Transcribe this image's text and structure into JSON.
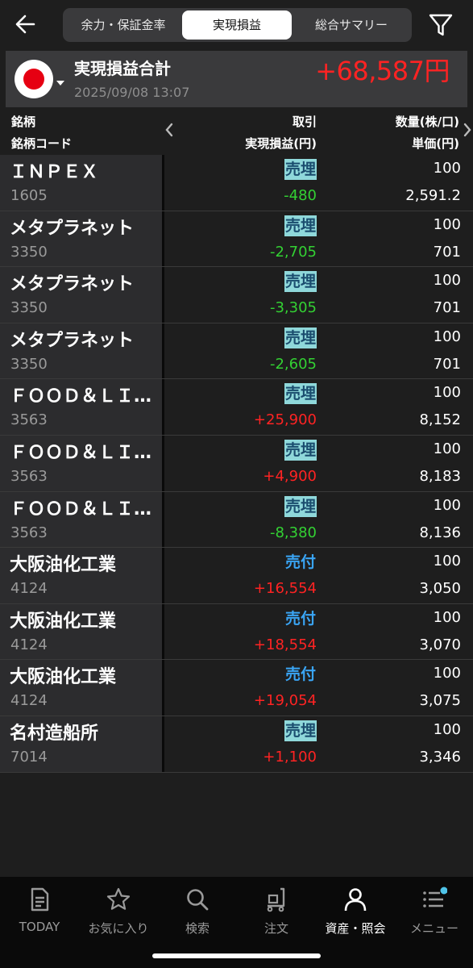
{
  "tabs": [
    {
      "label": "余力・保証金率"
    },
    {
      "label": "実現損益"
    },
    {
      "label": "総合サマリー"
    }
  ],
  "summary": {
    "title": "実現損益合計",
    "datetime": "2025/09/08 13:07",
    "total": "+68,587円",
    "market_flag": "japan-flag-icon"
  },
  "columns": {
    "name": "銘柄",
    "code": "銘柄コード",
    "trade": "取引",
    "pl": "実現損益(円)",
    "qty": "数量(株/口)",
    "price": "単価(円)"
  },
  "rows": [
    {
      "name": "ＩＮＰＥＸ",
      "code": "1605",
      "trade": "売埋",
      "trade_type": "sell-close",
      "pl": "-480",
      "pl_sign": "neg",
      "qty": "100",
      "price": "2,591.2"
    },
    {
      "name": "メタプラネット",
      "code": "3350",
      "trade": "売埋",
      "trade_type": "sell-close",
      "pl": "-2,705",
      "pl_sign": "neg",
      "qty": "100",
      "price": "701"
    },
    {
      "name": "メタプラネット",
      "code": "3350",
      "trade": "売埋",
      "trade_type": "sell-close",
      "pl": "-3,305",
      "pl_sign": "neg",
      "qty": "100",
      "price": "701"
    },
    {
      "name": "メタプラネット",
      "code": "3350",
      "trade": "売埋",
      "trade_type": "sell-close",
      "pl": "-2,605",
      "pl_sign": "neg",
      "qty": "100",
      "price": "701"
    },
    {
      "name": "ＦＯＯＤ＆ＬＩ…",
      "code": "3563",
      "trade": "売埋",
      "trade_type": "sell-close",
      "pl": "+25,900",
      "pl_sign": "pos",
      "qty": "100",
      "price": "8,152"
    },
    {
      "name": "ＦＯＯＤ＆ＬＩ…",
      "code": "3563",
      "trade": "売埋",
      "trade_type": "sell-close",
      "pl": "+4,900",
      "pl_sign": "pos",
      "qty": "100",
      "price": "8,183"
    },
    {
      "name": "ＦＯＯＤ＆ＬＩ…",
      "code": "3563",
      "trade": "売埋",
      "trade_type": "sell-close",
      "pl": "-8,380",
      "pl_sign": "neg",
      "qty": "100",
      "price": "8,136"
    },
    {
      "name": "大阪油化工業",
      "code": "4124",
      "trade": "売付",
      "trade_type": "sell-open",
      "pl": "+16,554",
      "pl_sign": "pos",
      "qty": "100",
      "price": "3,050"
    },
    {
      "name": "大阪油化工業",
      "code": "4124",
      "trade": "売付",
      "trade_type": "sell-open",
      "pl": "+18,554",
      "pl_sign": "pos",
      "qty": "100",
      "price": "3,070"
    },
    {
      "name": "大阪油化工業",
      "code": "4124",
      "trade": "売付",
      "trade_type": "sell-open",
      "pl": "+19,054",
      "pl_sign": "pos",
      "qty": "100",
      "price": "3,075"
    },
    {
      "name": "名村造船所",
      "code": "7014",
      "trade": "売埋",
      "trade_type": "sell-close",
      "pl": "+1,100",
      "pl_sign": "pos",
      "qty": "100",
      "price": "3,346"
    }
  ],
  "nav": [
    {
      "label": "TODAY",
      "icon": "document-icon"
    },
    {
      "label": "お気に入り",
      "icon": "star-icon"
    },
    {
      "label": "検索",
      "icon": "search-icon"
    },
    {
      "label": "注文",
      "icon": "cart-icon"
    },
    {
      "label": "資産・照会",
      "icon": "person-icon"
    },
    {
      "label": "メニュー",
      "icon": "menu-icon"
    }
  ],
  "colors": {
    "positive": "#ff2323",
    "negative": "#33d133",
    "sell_close_bg": "#8fd8da",
    "sell_open": "#3aa5f5"
  }
}
